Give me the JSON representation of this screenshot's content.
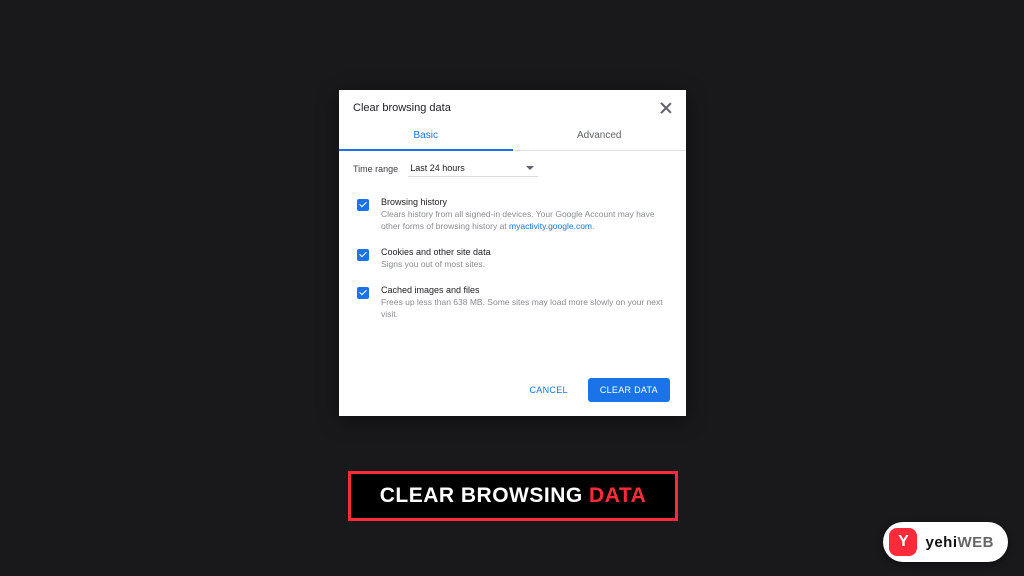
{
  "dialog": {
    "title": "Clear browsing data",
    "tabs": {
      "basic": "Basic",
      "advanced": "Advanced"
    },
    "time_label": "Time range",
    "time_value": "Last 24 hours",
    "options": [
      {
        "title": "Browsing history",
        "desc_prefix": "Clears history from all signed-in devices. Your Google Account may have other forms of browsing history at ",
        "desc_link": "myactivity.google.com",
        "desc_suffix": "."
      },
      {
        "title": "Cookies and other site data",
        "desc": "Signs you out of most sites."
      },
      {
        "title": "Cached images and files",
        "desc": "Frees up less than 638 MB. Some sites may load more slowly on your next visit."
      }
    ],
    "cancel": "CANCEL",
    "clear": "CLEAR DATA"
  },
  "banner": {
    "white": "CLEAR BROWSING ",
    "red": "DATA"
  },
  "brand": {
    "icon": "Y",
    "name_y": "yehi",
    "name_web": "WEB"
  }
}
